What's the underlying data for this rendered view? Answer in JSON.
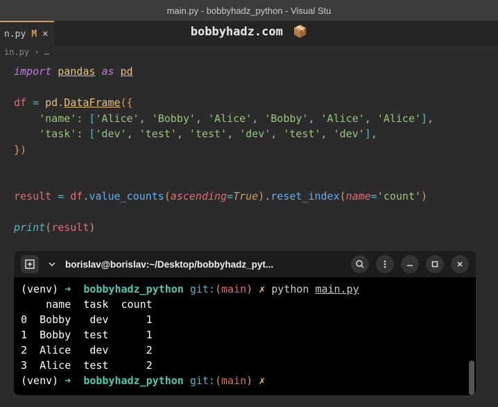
{
  "titlebar": "main.py - bobbyhadz_python - Visual Stu",
  "tab": {
    "name": "n.py",
    "modified": "M",
    "close": "×"
  },
  "watermark": {
    "text": "bobbyhadz.com",
    "icon": "📦"
  },
  "breadcrumb": {
    "file": "in.py",
    "sep": "›",
    "rest": "…"
  },
  "code": {
    "l1": {
      "import": "import",
      "module": "pandas",
      "as": "as",
      "alias": "pd"
    },
    "l3": {
      "var": "df",
      "eq": "=",
      "ns": "pd",
      "dot": ".",
      "cls": "DataFrame",
      "open": "({"
    },
    "l4": {
      "key": "'name'",
      "colon": ":",
      "lb": "[",
      "v1": "'Alice'",
      "v2": "'Bobby'",
      "v3": "'Alice'",
      "v4": "'Bobby'",
      "v5": "'Alice'",
      "v6": "'Alice'",
      "rb": "]",
      "c": ","
    },
    "l5": {
      "key": "'task'",
      "colon": ":",
      "lb": "[",
      "v1": "'dev'",
      "v2": "'test'",
      "v3": "'test'",
      "v4": "'dev'",
      "v5": "'test'",
      "v6": "'dev'",
      "rb": "]",
      "c": ","
    },
    "l6": {
      "close": "})"
    },
    "l9": {
      "var": "result",
      "eq": "=",
      "df": "df",
      "dot": ".",
      "vc": "value_counts",
      "lp": "(",
      "asc": "ascending",
      "keq": "=",
      "true": "True",
      "rp": ")",
      "ri": "reset_index",
      "lp2": "(",
      "name": "name",
      "keq2": "=",
      "count": "'count'",
      "rp2": ")"
    },
    "l11": {
      "print": "print",
      "lp": "(",
      "arg": "result",
      "rp": ")"
    }
  },
  "terminal": {
    "title": "borislav@borislav:~/Desktop/bobbyhadz_pyt...",
    "prompt": {
      "venv": "(venv)",
      "arrow": "➜",
      "path": "bobbyhadz_python",
      "git": "git:",
      "lp": "(",
      "branch": "main",
      "rp": ")",
      "flash": "✗"
    },
    "cmd": {
      "python": "python",
      "file": "main.py"
    },
    "output": {
      "header": "    name  task  count",
      "r0": "0  Bobby   dev      1",
      "r1": "1  Bobby  test      1",
      "r2": "2  Alice   dev      2",
      "r3": "3  Alice  test      2"
    }
  }
}
